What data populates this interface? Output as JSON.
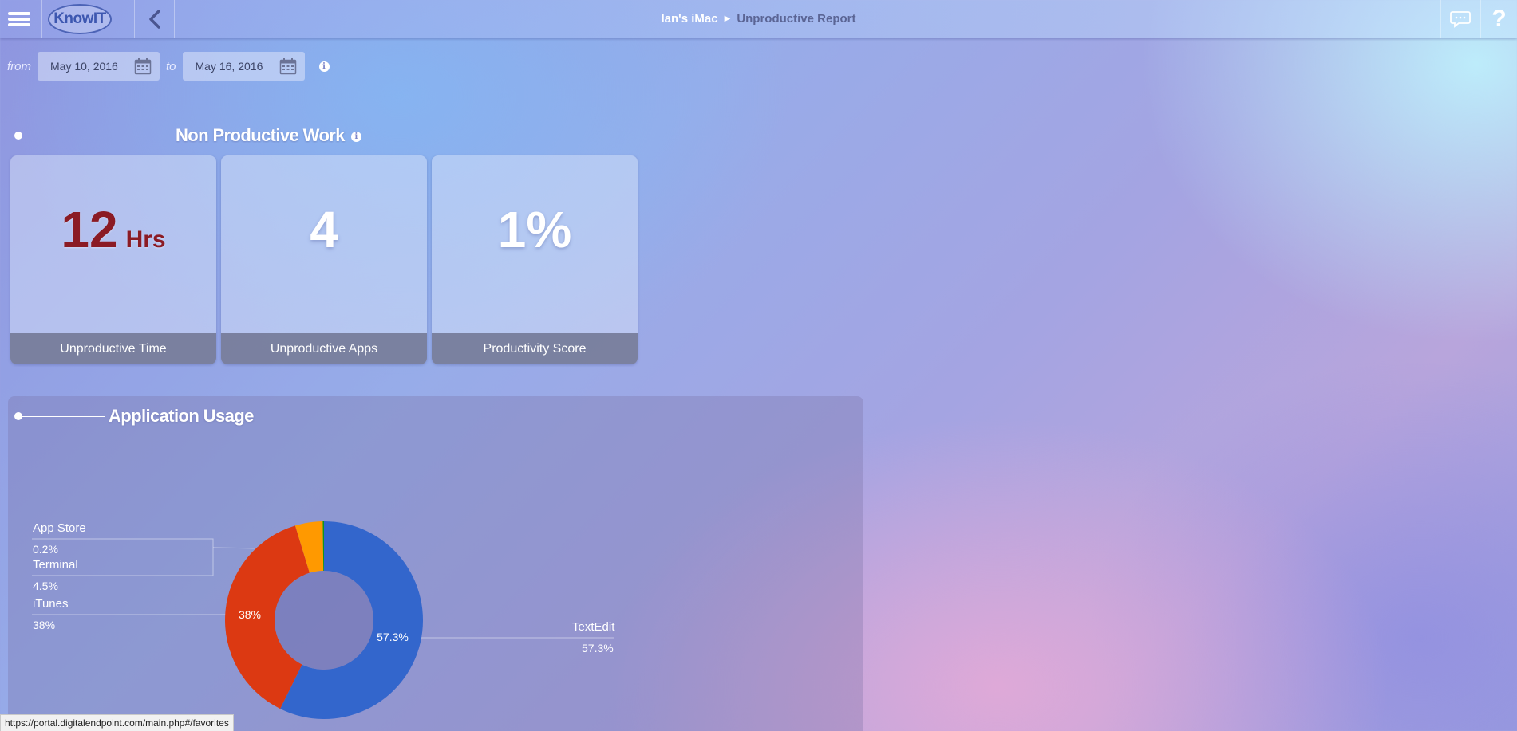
{
  "header": {
    "logo_text": "KnowIT",
    "breadcrumb": [
      "Ian's iMac",
      "Unproductive Report"
    ],
    "icons": [
      "menu-icon",
      "chevron-left-icon",
      "chat-icon",
      "help-icon"
    ]
  },
  "date_range": {
    "from_label": "from",
    "from_value": "May 10, 2016",
    "to_label": "to",
    "to_value": "May 16, 2016"
  },
  "non_productive": {
    "title": "Non Productive Work",
    "cards": [
      {
        "value": "12",
        "unit": "Hrs",
        "label": "Unproductive Time",
        "color": "#8b1b24"
      },
      {
        "value": "4",
        "unit": "",
        "label": "Unproductive Apps",
        "color": "#ffffff"
      },
      {
        "value": "1%",
        "unit": "",
        "label": "Productivity Score",
        "color": "#ffffff"
      }
    ]
  },
  "app_usage": {
    "title": "Application Usage",
    "legend": [
      {
        "name": "App Store",
        "pct": "0.2%"
      },
      {
        "name": "Terminal",
        "pct": "4.5%"
      },
      {
        "name": "iTunes",
        "pct": "38%"
      },
      {
        "name": "TextEdit",
        "pct": "57.3%"
      }
    ],
    "slice_labels": {
      "itunes": "38%",
      "textedit": "57.3%"
    }
  },
  "chart_data": {
    "type": "pie",
    "donut": true,
    "categories": [
      "TextEdit",
      "iTunes",
      "Terminal",
      "App Store"
    ],
    "values": [
      57.3,
      38,
      4.5,
      0.2
    ],
    "colors": [
      "#3366cc",
      "#dc3912",
      "#ff9900",
      "#109618"
    ]
  },
  "status_url": "https://portal.digitalendpoint.com/main.php#/favorites"
}
